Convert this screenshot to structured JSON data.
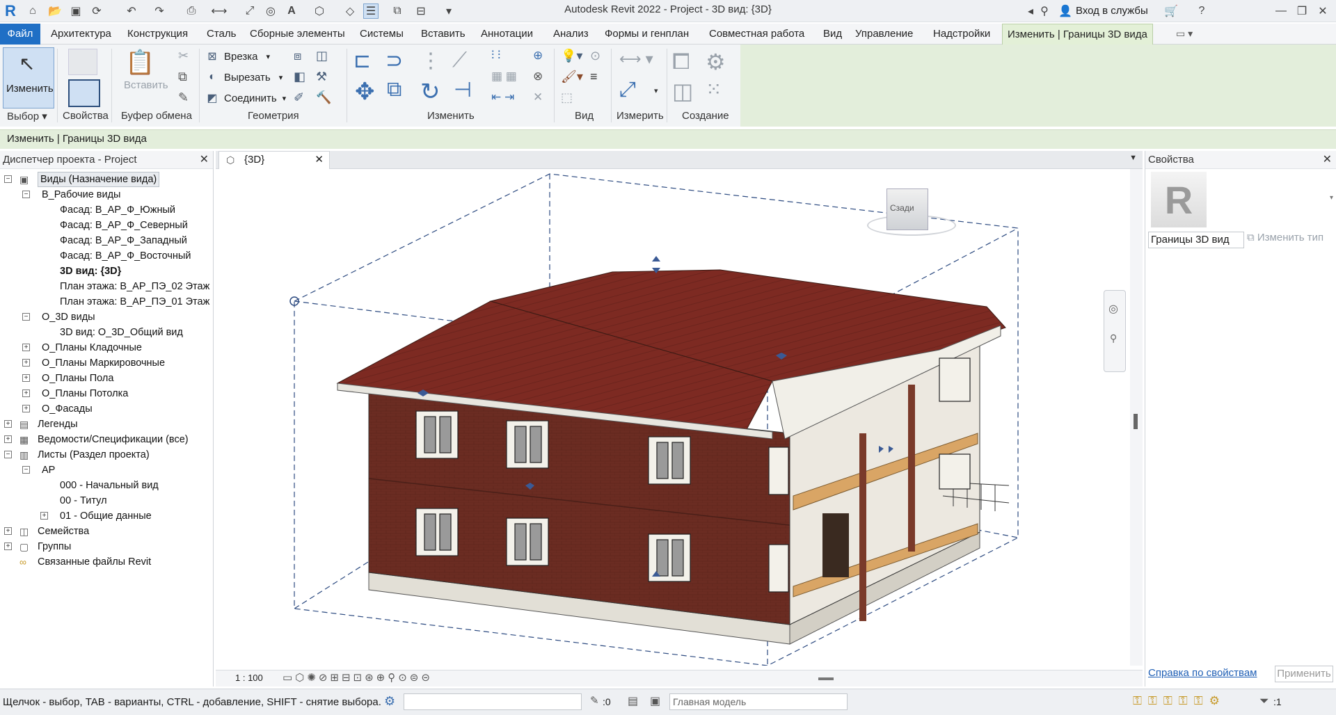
{
  "app": {
    "title": "Autodesk Revit 2022 - Project - 3D вид: {3D}",
    "logo": "R"
  },
  "qat": {
    "signin_label": "Вход в службы"
  },
  "menu": {
    "file": "Файл",
    "tabs": [
      "Архитектура",
      "Конструкция",
      "Сталь",
      "Сборные элементы",
      "Системы",
      "Вставить",
      "Аннотации",
      "Анализ",
      "Формы и генплан",
      "Совместная работа",
      "Вид",
      "Управление",
      "Надстройки"
    ],
    "active_tab": "Изменить | Границы 3D вида"
  },
  "ribbon": {
    "modify_label": "Изменить",
    "paste_label": "Вставить",
    "cope_label": "Врезка",
    "cut_label": "Вырезать",
    "join_label": "Соединить",
    "groups": [
      "Выбор",
      "Свойства",
      "Буфер обмена",
      "Геометрия",
      "Изменить",
      "Вид",
      "Измерить",
      "Создание"
    ]
  },
  "context_bar": {
    "text": "Изменить | Границы 3D вида"
  },
  "project_browser": {
    "title": "Диспетчер проекта - Project",
    "nodes": [
      {
        "label": "Виды (Назначение вида)",
        "level": 0,
        "toggle": "−",
        "icon": "views-icon",
        "bold": false,
        "selected": true
      },
      {
        "label": "В_Рабочие виды",
        "level": 1,
        "toggle": "−"
      },
      {
        "label": "Фасад: В_АР_Ф_Южный",
        "level": 2
      },
      {
        "label": "Фасад: В_АР_Ф_Северный",
        "level": 2
      },
      {
        "label": "Фасад: В_АР_Ф_Западный",
        "level": 2
      },
      {
        "label": "Фасад: В_АР_Ф_Восточный",
        "level": 2
      },
      {
        "label": "3D вид: {3D}",
        "level": 2,
        "bold": true
      },
      {
        "label": "План этажа: В_АР_ПЭ_02 Этаж",
        "level": 2
      },
      {
        "label": "План этажа: В_АР_ПЭ_01 Этаж",
        "level": 2
      },
      {
        "label": "О_3D виды",
        "level": 1,
        "toggle": "−"
      },
      {
        "label": "3D вид: О_3D_Общий вид",
        "level": 2
      },
      {
        "label": "О_Планы Кладочные",
        "level": 1,
        "toggle": "+"
      },
      {
        "label": "О_Планы Маркировочные",
        "level": 1,
        "toggle": "+"
      },
      {
        "label": "О_Планы Пола",
        "level": 1,
        "toggle": "+"
      },
      {
        "label": "О_Планы Потолка",
        "level": 1,
        "toggle": "+"
      },
      {
        "label": "О_Фасады",
        "level": 1,
        "toggle": "+"
      },
      {
        "label": "Легенды",
        "level": 0,
        "toggle": "+",
        "icon": "legend-icon"
      },
      {
        "label": "Ведомости/Спецификации (все)",
        "level": 0,
        "toggle": "+",
        "icon": "schedule-icon"
      },
      {
        "label": "Листы (Раздел проекта)",
        "level": 0,
        "toggle": "−",
        "icon": "sheets-icon"
      },
      {
        "label": "АР",
        "level": 1,
        "toggle": "−"
      },
      {
        "label": "000 - Начальный вид",
        "level": 2
      },
      {
        "label": "00 - Титул",
        "level": 2
      },
      {
        "label": "01 - Общие данные",
        "level": 2,
        "toggle": "+"
      },
      {
        "label": "Семейства",
        "level": 0,
        "toggle": "+",
        "icon": "families-icon"
      },
      {
        "label": "Группы",
        "level": 0,
        "toggle": "+",
        "icon": "groups-icon"
      },
      {
        "label": "Связанные файлы Revit",
        "level": 0,
        "icon": "links-icon"
      }
    ]
  },
  "view": {
    "tab_label": "{3D}",
    "scale": "1 : 100",
    "viewcube_label": "Сзади"
  },
  "properties": {
    "title": "Свойства",
    "type_value": "Границы 3D вид",
    "edit_type": "Изменить тип",
    "help_link": "Справка по свойствам",
    "apply": "Применить"
  },
  "status": {
    "hint": "Щелчок - выбор, TAB - варианты, CTRL - добавление, SHIFT - снятие выбора.",
    "count": ":0",
    "model": "Главная модель",
    "filter_count": ":1"
  }
}
